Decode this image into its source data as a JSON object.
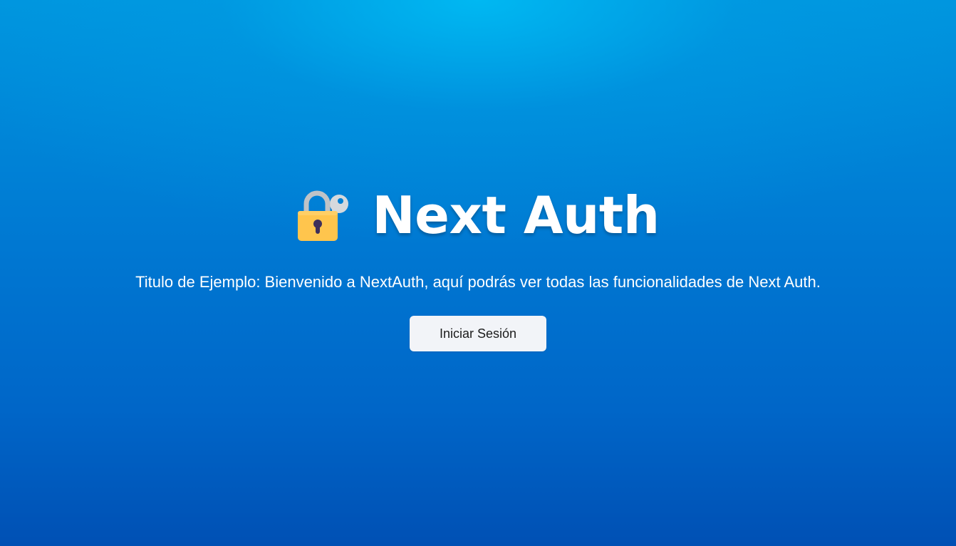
{
  "hero": {
    "icon": "locked-with-key-icon",
    "title": "Next Auth"
  },
  "subtitle": "Titulo de Ejemplo: Bienvenido a NextAuth, aquí podrás ver todas las funcionalidades de Next Auth.",
  "actions": {
    "login_label": "Iniciar Sesión"
  },
  "colors": {
    "background_top": "#00b4ee",
    "background_bottom": "#0050b4",
    "button_bg": "#f2f4f8",
    "lock_body": "#ffc54d",
    "shackle": "#bfc3c7",
    "keyhole": "#3e2f5b"
  }
}
